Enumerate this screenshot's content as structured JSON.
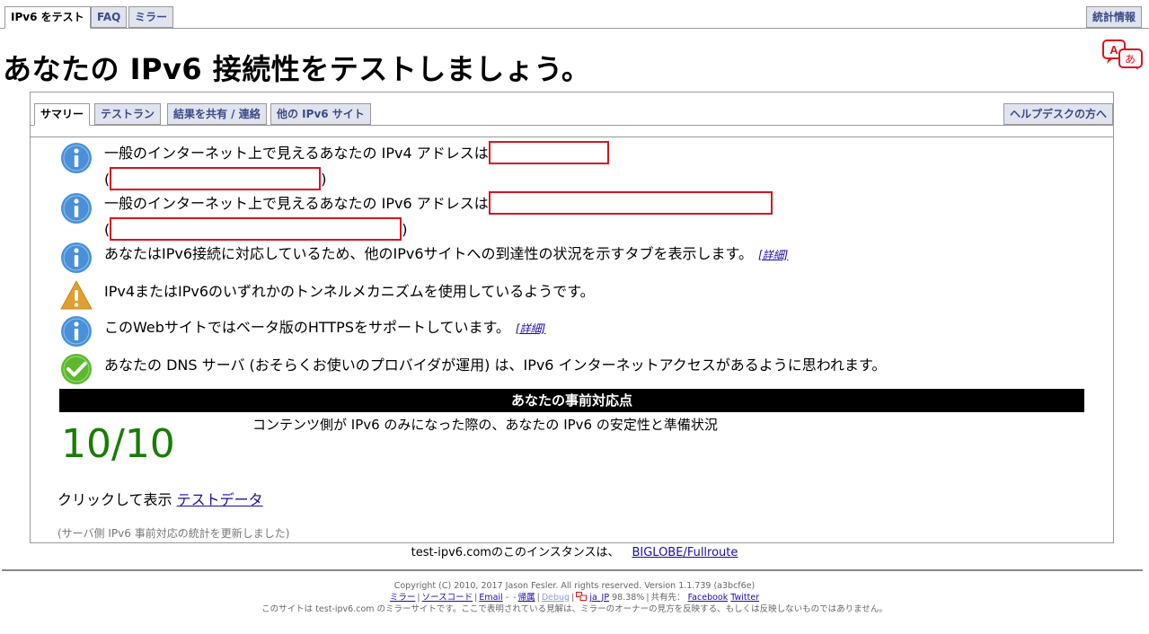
{
  "top_tabs": {
    "test": "IPv6 をテスト",
    "faq": "FAQ",
    "mirror": "ミラー",
    "stats": "統計情報"
  },
  "page_title": "あなたの IPv6 接続性をテストしましょう。",
  "sub_tabs": {
    "summary": "サマリー",
    "testrun": "テストラン",
    "share": "結果を共有 / 連絡",
    "other_sites": "他の IPv6 サイト",
    "helpdesk": "ヘルプデスクの方へ"
  },
  "results": [
    {
      "icon": "info-icon",
      "text": "一般のインターネット上で見えるあなたの IPv4 アドレスは",
      "sub_close": ")"
    },
    {
      "icon": "info-icon",
      "text": "一般のインターネット上で見えるあなたの IPv6 アドレスは",
      "sub_close": ")"
    },
    {
      "icon": "info-icon",
      "text": "あなたはIPv6接続に対応しているため、他のIPv6サイトへの到達性の状況を示すタブを表示します。",
      "link": "[詳細]"
    },
    {
      "icon": "warning-icon",
      "text": "IPv4またはIPv6のいずれかのトンネルメカニズムを使用しているようです。"
    },
    {
      "icon": "info-icon",
      "text": "このWebサイトではベータ版のHTTPSをサポートしています。",
      "link": "[詳細]"
    },
    {
      "icon": "check-icon",
      "text": "あなたの DNS サーバ (おそらくお使いのプロバイダが運用) は、IPv6 インターネットアクセスがあるように思われます。"
    }
  ],
  "score_section": {
    "header": "あなたの事前対応点",
    "score": "10/10",
    "description": "コンテンツ側が IPv6 のみになった際の、あなたの IPv6 の安定性と準備状況"
  },
  "click_show": {
    "prefix": "クリックして表示",
    "link": "テストデータ"
  },
  "server_note": "(サーバ側 IPv6 事前対応の統計を更新しました)",
  "instance": {
    "text": "test-ipv6.comのこのインスタンスは、",
    "link": "BIGLOBE/Fullroute"
  },
  "footer": {
    "copyright": "Copyright (C) 2010, 2017 Jason Fesler. All rights reserved. Version 1.1.739 (a3bcf6e)",
    "links": {
      "mirror": "ミラー",
      "source": "ソースコード",
      "email": "Email",
      "dash": "-",
      "attrib": "帰属",
      "debug": "Debug",
      "lang": "ja_JP",
      "lang_pct": "98.38%",
      "share": "共有先：",
      "facebook": "Facebook",
      "twitter": "Twitter"
    },
    "disclaimer": "このサイトは test-ipv6.com のミラーサイトです。ここで表明されている見解は、ミラーのオーナーの見方を反映する、もしくは反映しないものではありません。"
  },
  "colors": {
    "info": "#4a90d9",
    "warning": "#e0a030",
    "ok": "#5cb82e",
    "score": "#1a7c06",
    "redaction": "#d9141e",
    "tab_inactive": "#dfe4ef",
    "tab_text": "#3c4a86"
  }
}
